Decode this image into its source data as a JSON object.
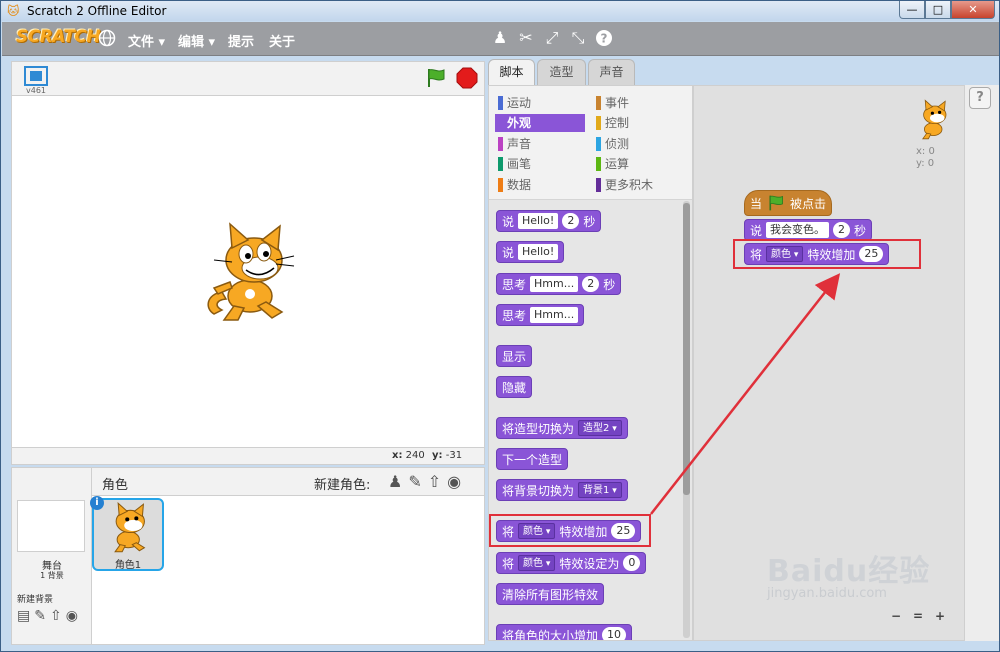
{
  "window": {
    "title": "Scratch 2 Offline Editor"
  },
  "menubar": {
    "logo": "SCRATCH",
    "menus": [
      "文件 ▾",
      "编辑 ▾",
      "提示",
      "关于"
    ]
  },
  "stage": {
    "version": "v461",
    "x_label": "x:",
    "x_value": "240",
    "y_label": "y:",
    "y_value": "-31"
  },
  "sprites": {
    "stage_label": "舞台",
    "stage_backdrop_count": "1 背景",
    "new_backdrop_label": "新建背景",
    "sprites_title": "角色",
    "new_sprite_label": "新建角色:",
    "sprite_name": "角色1"
  },
  "tabs": [
    "脚本",
    "造型",
    "声音"
  ],
  "categories": {
    "left": [
      "运动",
      "外观",
      "声音",
      "画笔",
      "数据"
    ],
    "right": [
      "事件",
      "控制",
      "侦测",
      "运算",
      "更多积木"
    ],
    "active": "外观",
    "colors": {
      "运动": "#4a6cd4",
      "外观": "#8a55d7",
      "声音": "#bb42c3",
      "画笔": "#0e9a6c",
      "数据": "#ee7d16",
      "事件": "#c88330",
      "控制": "#e1a91a",
      "侦测": "#2ca5e2",
      "运算": "#5cb712",
      "更多积木": "#632d99"
    }
  },
  "palette_blocks": {
    "say_secs": {
      "verb": "说",
      "text": "Hello!",
      "num": "2",
      "unit": "秒"
    },
    "say": {
      "verb": "说",
      "text": "Hello!"
    },
    "think_secs": {
      "verb": "思考",
      "text": "Hmm...",
      "num": "2",
      "unit": "秒"
    },
    "think": {
      "verb": "思考",
      "text": "Hmm..."
    },
    "show": "显示",
    "hide": "隐藏",
    "switch_costume": {
      "label": "将造型切换为",
      "dd": "造型2"
    },
    "next_costume": "下一个造型",
    "switch_backdrop": {
      "label": "将背景切换为",
      "dd": "背景1"
    },
    "change_effect": {
      "verb": "将",
      "dd": "颜色",
      "label": "特效增加",
      "num": "25"
    },
    "set_effect": {
      "verb": "将",
      "dd": "颜色",
      "label": "特效设定为",
      "num": "0"
    },
    "clear_effects": "清除所有图形特效",
    "change_size": {
      "label": "将角色的大小增加",
      "num": "10"
    }
  },
  "script": {
    "hat": {
      "when": "当",
      "clicked": "被点击"
    },
    "say": {
      "verb": "说",
      "text": "我会变色。",
      "num": "2",
      "unit": "秒"
    },
    "change": {
      "verb": "将",
      "dd": "颜色",
      "label": "特效增加",
      "num": "25"
    },
    "sprite_x": "x: 0",
    "sprite_y": "y: 0"
  },
  "help_label": "?",
  "zoom": [
    "−",
    "=",
    "+"
  ],
  "watermark": {
    "main": "Baidu经验",
    "sub": "jingyan.baidu.com"
  }
}
